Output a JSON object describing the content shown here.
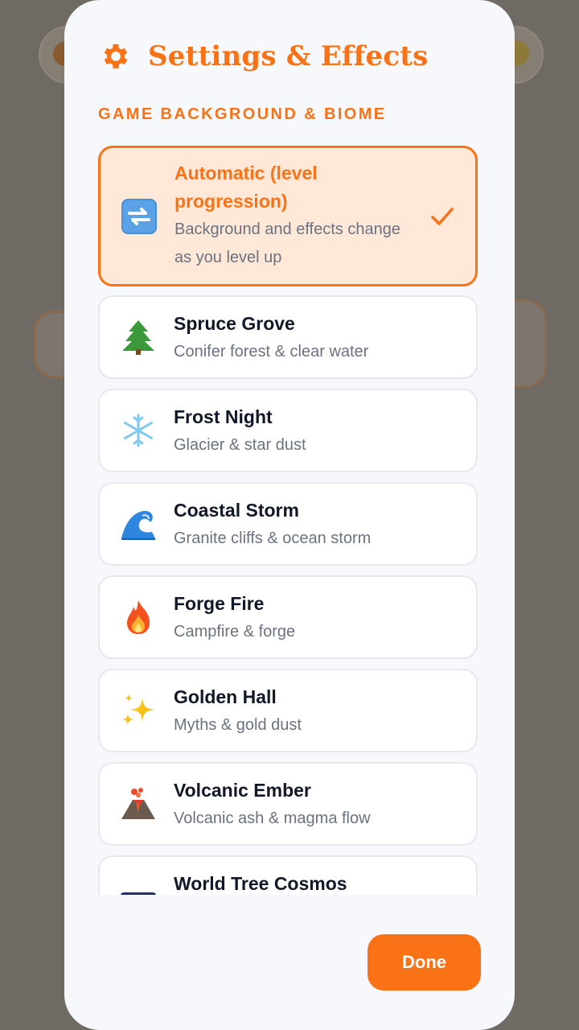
{
  "modal": {
    "title": "Settings & Effects",
    "section_label": "GAME BACKGROUND & BIOME",
    "done_label": "Done",
    "accent_color": "#f97316"
  },
  "options": [
    {
      "title": "Automatic (level progression)",
      "description": "Background and effects change as you level up",
      "icon": "refresh-emoji",
      "selected": true
    },
    {
      "title": "Spruce Grove",
      "description": "Conifer forest & clear water",
      "icon": "evergreen-tree-emoji",
      "selected": false
    },
    {
      "title": "Frost Night",
      "description": "Glacier & star dust",
      "icon": "snowflake-emoji",
      "selected": false
    },
    {
      "title": "Coastal Storm",
      "description": "Granite cliffs & ocean storm",
      "icon": "wave-emoji",
      "selected": false
    },
    {
      "title": "Forge Fire",
      "description": "Campfire & forge",
      "icon": "fire-emoji",
      "selected": false
    },
    {
      "title": "Golden Hall",
      "description": "Myths & gold dust",
      "icon": "sparkles-emoji",
      "selected": false
    },
    {
      "title": "Volcanic Ember",
      "description": "Volcanic ash & magma flow",
      "icon": "volcano-emoji",
      "selected": false
    },
    {
      "title": "World Tree Cosmos",
      "description": "",
      "icon": "night-sky-emoji",
      "selected": false
    }
  ]
}
